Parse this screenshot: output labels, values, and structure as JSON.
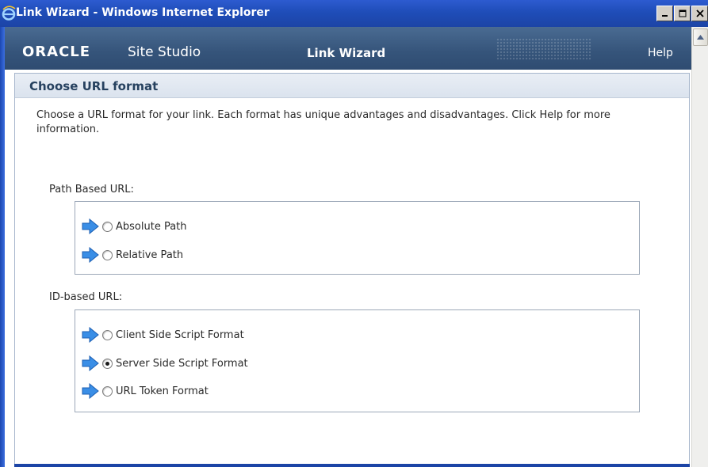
{
  "window": {
    "title": "Link Wizard - Windows Internet Explorer",
    "controls": [
      "minimize",
      "maximize",
      "close"
    ]
  },
  "header": {
    "brand": "ORACLE",
    "product": "Site Studio",
    "title": "Link Wizard",
    "help_label": "Help"
  },
  "panel": {
    "heading": "Choose URL format",
    "intro": "Choose a URL format for your link. Each format has unique advantages and disadvantages. Click Help for more information."
  },
  "groups": [
    {
      "label": "Path Based URL:",
      "options": [
        {
          "label": "Absolute Path",
          "selected": false
        },
        {
          "label": "Relative Path",
          "selected": false
        }
      ]
    },
    {
      "label": "ID-based URL:",
      "options": [
        {
          "label": "Client Side Script Format",
          "selected": false
        },
        {
          "label": "Server Side Script Format",
          "selected": true
        },
        {
          "label": "URL Token Format",
          "selected": false
        }
      ]
    }
  ],
  "icons": {
    "app": "internet-explorer-icon",
    "option_marker": "blue-arrow-icon"
  },
  "colors": {
    "titlebar": "#1f4db8",
    "app_header": "#35547a",
    "heading_text": "#26415f",
    "arrow": "#3a8ee6"
  }
}
